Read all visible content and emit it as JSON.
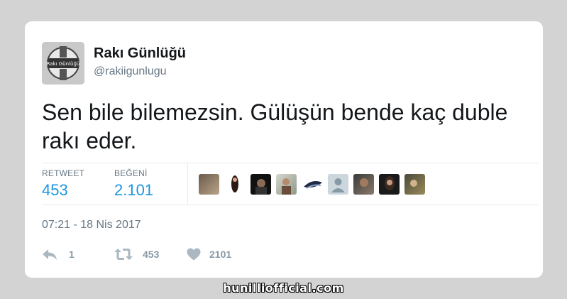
{
  "tweet": {
    "author_name": "Rakı Günlüğü",
    "author_handle": "@rakiigunlugu",
    "text": "Sen bile bilemezsin. Gülüşün bende kaç duble rakı eder.",
    "timestamp": "07:21 - 18 Nis 2017"
  },
  "stats": {
    "retweet_label": "RETWEET",
    "retweet_value": "453",
    "like_label": "BEĞENİ",
    "like_value": "2.101"
  },
  "likers": [
    "avatar-1",
    "avatar-2",
    "avatar-3",
    "avatar-4",
    "avatar-5",
    "avatar-default",
    "avatar-7",
    "avatar-8",
    "avatar-9"
  ],
  "actions": {
    "reply_count": "1",
    "retweet_count": "453",
    "like_count": "2101"
  },
  "icons": {
    "reply": "reply-icon",
    "retweet": "retweet-icon",
    "like": "heart-icon"
  },
  "colors": {
    "accent": "#1b95e0",
    "muted": "#657786",
    "icon": "#aab8c2",
    "background": "#d3d3d3"
  },
  "watermark": "hunilliofficial.com"
}
